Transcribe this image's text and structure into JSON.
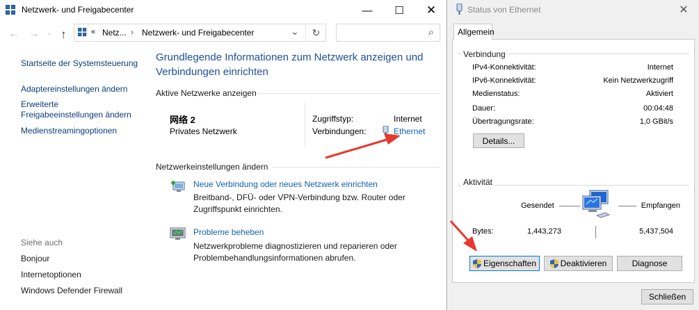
{
  "left_window": {
    "title": "Netzwerk- und Freigabecenter",
    "caption": {
      "minimize": "—",
      "maximize": "☐",
      "close": "✕"
    },
    "nav": {
      "back": "←",
      "forward": "→",
      "up": "↑"
    },
    "address": {
      "prefix": "«",
      "crumb1": "Netz...",
      "sep": "›",
      "crumb2": "Netzwerk- und Freigabecenter",
      "dropdown": "⌄",
      "refresh": "↻"
    },
    "search": {
      "placeholder": "",
      "icon": "⌕"
    },
    "sidebar": {
      "links": [
        "Startseite der Systemsteuerung",
        "Adaptereinstellungen ändern",
        "Erweiterte",
        "Freigabeeinstellungen ändern",
        "Medienstreamingoptionen"
      ],
      "see_also_heading": "Siehe auch",
      "see_also": [
        "Bonjour",
        "Internetoptionen",
        "Windows Defender Firewall"
      ]
    },
    "main": {
      "title_line1": "Grundlegende Informationen zum Netzwerk anzeigen und",
      "title_line2": "Verbindungen einrichten",
      "active_heading": "Aktive Netzwerke anzeigen",
      "network_name": "网络 2",
      "network_type": "Privates Netzwerk",
      "access_type_label": "Zugriffstyp:",
      "access_type_value": "Internet",
      "connections_label": "Verbindungen:",
      "connections_value": "Ethernet",
      "change_heading": "Netzwerkeinstellungen ändern",
      "task1_title": "Neue Verbindung oder neues Netzwerk einrichten",
      "task1_desc_line1": "Breitband-, DFÜ- oder VPN-Verbindung bzw. Router oder",
      "task1_desc_line2": "Zugriffspunkt einrichten.",
      "task2_title": "Probleme beheben",
      "task2_desc_line1": "Netzwerkprobleme diagnostizieren und reparieren oder",
      "task2_desc_line2": "Problembehandlungsinformationen abrufen."
    }
  },
  "right_window": {
    "title": "Status von Ethernet",
    "close": "✕",
    "tab": "Allgemein",
    "connection_heading": "Verbindung",
    "rows": [
      {
        "label": "IPv4-Konnektivität:",
        "value": "Internet"
      },
      {
        "label": "IPv6-Konnektivität:",
        "value": "Kein Netzwerkzugriff"
      },
      {
        "label": "Medienstatus:",
        "value": "Aktiviert"
      },
      {
        "label": "Dauer:",
        "value": "00:04:48"
      },
      {
        "label": "Übertragungsrate:",
        "value": "1,0 GBit/s"
      }
    ],
    "details_button": "Details...",
    "activity_heading": "Aktivität",
    "sent_label": "Gesendet",
    "received_label": "Empfangen",
    "bytes_label": "Bytes:",
    "bytes_sent": "1,443,273",
    "bytes_received": "5,437,504",
    "properties_button": "Eigenschaften",
    "disable_button": "Deaktivieren",
    "diagnose_button": "Diagnose",
    "close_button": "Schließen"
  },
  "colors": {
    "link": "#1262b3",
    "title": "#1e4f9c",
    "annotation_arrow": "#e8372c"
  }
}
